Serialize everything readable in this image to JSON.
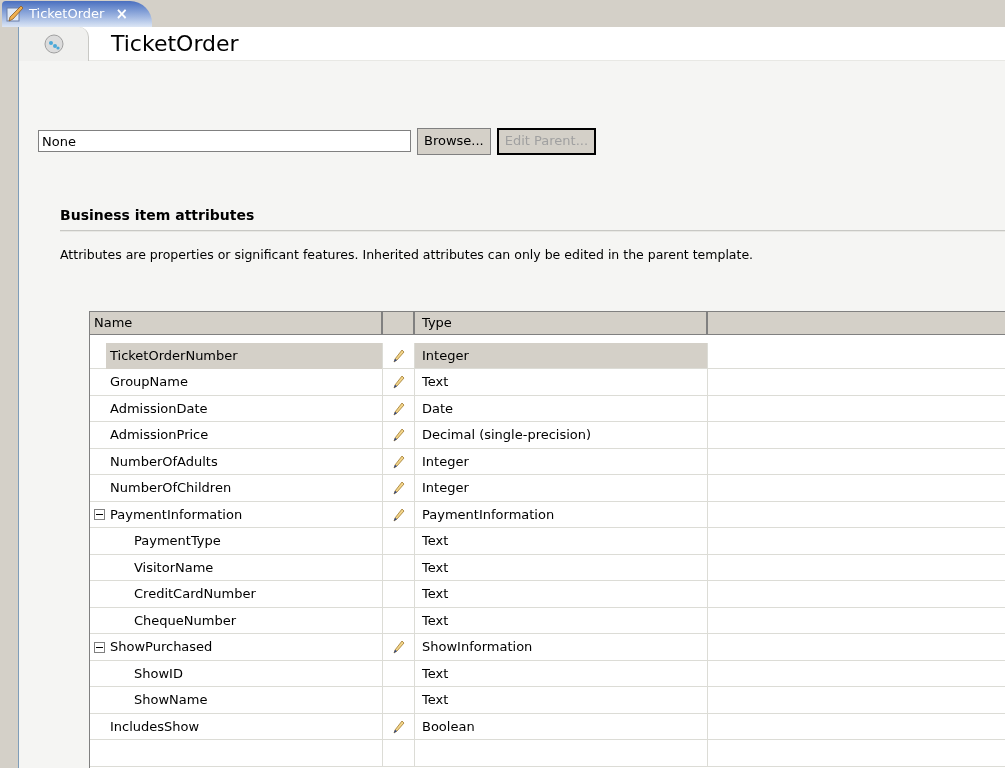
{
  "tab": {
    "title": "TicketOrder",
    "close": "×"
  },
  "header": {
    "title": "TicketOrder"
  },
  "parent": {
    "value": "None",
    "buttons": [
      {
        "label": "Browse...",
        "disabled": false,
        "focused": false
      },
      {
        "label": "Edit Parent...",
        "disabled": true,
        "focused": true
      }
    ]
  },
  "section": {
    "title": "Business item attributes",
    "description": "Attributes are properties or significant features. Inherited attributes can only be edited in the parent template."
  },
  "table": {
    "columns": [
      {
        "label": "Name"
      },
      {
        "label": "Type"
      }
    ],
    "rows": [
      {
        "name": "TicketOrderNumber",
        "type": "Integer",
        "editable": true,
        "selected": true
      },
      {
        "name": "GroupName",
        "type": "Text",
        "editable": true,
        "selected": false
      },
      {
        "name": "AdmissionDate",
        "type": "Date",
        "editable": true,
        "selected": false
      },
      {
        "name": "AdmissionPrice",
        "type": "Decimal (single-precision)",
        "editable": true,
        "selected": false
      },
      {
        "name": "NumberOfAdults",
        "type": "Integer",
        "editable": true,
        "selected": false
      },
      {
        "name": "NumberOfChildren",
        "type": "Integer",
        "editable": true,
        "selected": false
      },
      {
        "name": "PaymentInformation",
        "type": "PaymentInformation",
        "editable": true,
        "selected": false,
        "expanded": true,
        "children": [
          {
            "name": "PaymentType",
            "type": "Text",
            "editable": false,
            "selected": false
          },
          {
            "name": "VisitorName",
            "type": "Text",
            "editable": false,
            "selected": false
          },
          {
            "name": "CreditCardNumber",
            "type": "Text",
            "editable": false,
            "selected": false
          },
          {
            "name": "ChequeNumber",
            "type": "Text",
            "editable": false,
            "selected": false
          }
        ]
      },
      {
        "name": "ShowPurchased",
        "type": "ShowInformation",
        "editable": true,
        "selected": false,
        "expanded": true,
        "children": [
          {
            "name": "ShowID",
            "type": "Text",
            "editable": false,
            "selected": false
          },
          {
            "name": "ShowName",
            "type": "Text",
            "editable": false,
            "selected": false
          }
        ]
      },
      {
        "name": "IncludesShow",
        "type": "Boolean",
        "editable": true,
        "selected": false
      }
    ]
  }
}
